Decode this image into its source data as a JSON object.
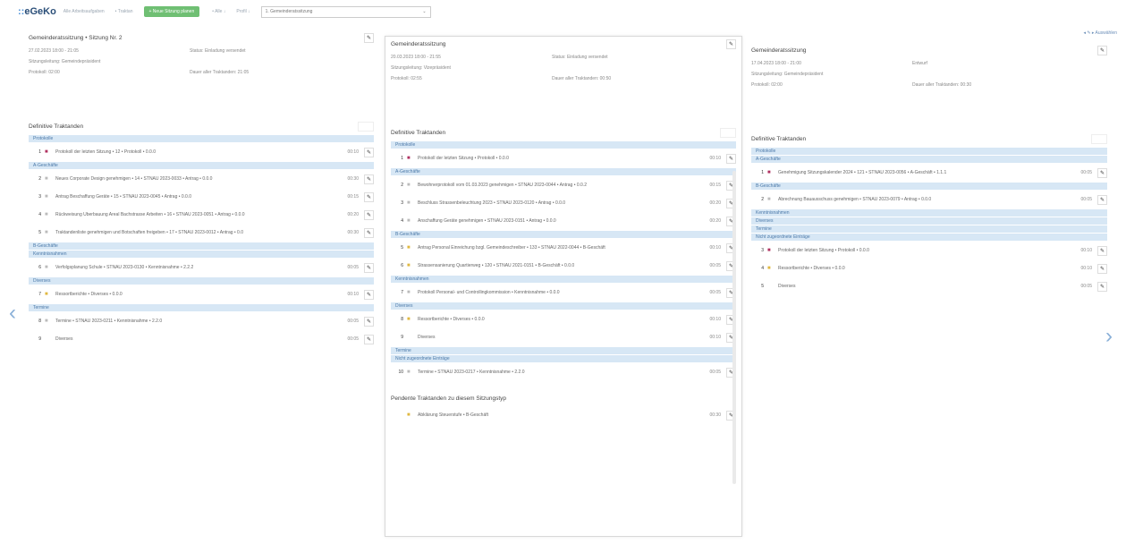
{
  "app": {
    "logo_prefix": "::",
    "logo": "eGeKo",
    "link": "Alle Arbeitsaufgaben"
  },
  "topbar": {
    "nav1": "• Traktan",
    "new_button": "+ Neue Sitzung planen",
    "nav2": "• Alle ↓",
    "nav3": "Profil ↓",
    "selected": "1. Gemeinderatssitzung",
    "caret": "⌄"
  },
  "top_right": "◂ ✎ ▸ Auswählen",
  "edit_symbol": "✎",
  "panels": {
    "left": {
      "title": "Gemeinderatssitzung • Sitzung Nr. 2",
      "meta": [
        "27.02.2023 18:00 - 21:05",
        "Status: Einladung versendet",
        "Sitzungsleitung: Gemeindepräsident",
        "",
        "Protokoll: 02:00",
        "Dauer aller Traktanden: 21:05"
      ],
      "section": "Definitive Traktanden",
      "groups": [
        {
          "cat": "Protokolle",
          "items": [
            {
              "n": "1",
              "dot": "■",
              "c": "#b03060",
              "t": "Protokoll der letzten Sitzung • 12 • Protokoll • 0.0.0",
              "time": "00:10"
            }
          ]
        },
        {
          "cat": "A-Geschäfte",
          "items": [
            {
              "n": "2",
              "dot": "■",
              "c": "#bbb",
              "t": "Neues Corporate Design genehmigen • 14 • STNAU 2023-0033 • Antrag • 0.0.0",
              "time": "00:30"
            },
            {
              "n": "3",
              "dot": "■",
              "c": "#bbb",
              "t": "Antrag Beschaffung Geräte • 15 • STNAU 2023-0045 • Antrag • 0.0.0",
              "time": "00:15"
            },
            {
              "n": "4",
              "dot": "■",
              "c": "#bbb",
              "t": "Rückweisung Überbauung Areal Bachstrasse Arbeiten • 16 • STNAU 2023-0051 • Antrag • 0.0.0",
              "time": "00:20"
            },
            {
              "n": "5",
              "dot": "■",
              "c": "#bbb",
              "t": "Traktandenliste genehmigen und Botschaften freigeben • 17 • STNAU 2023-0012 • Antrag • 0.0",
              "time": "00:30"
            }
          ]
        },
        {
          "cat": "B-Geschäfte",
          "items": []
        },
        {
          "cat": "Kenntnisnahmen",
          "items": [
            {
              "n": "6",
              "dot": "■",
              "c": "#bbb",
              "t": "Verfolgsplanung Schule • STNAU 2023-0130 • Kenntnisnahme • 2.2.2",
              "time": "00:05"
            }
          ]
        },
        {
          "cat": "Diverses",
          "items": [
            {
              "n": "7",
              "dot": "■",
              "c": "#e0b840",
              "t": "Ressortberichte • Diverses • 0.0.0",
              "time": "00:10"
            }
          ]
        },
        {
          "cat": "Termine",
          "items": [
            {
              "n": "8",
              "dot": "■",
              "c": "#bbb",
              "t": "Termine • STNAU 2023-0211 • Kenntnisnahme • 2.2.0",
              "time": "00:05"
            },
            {
              "n": "9",
              "dot": "",
              "c": "#bbb",
              "t": "Diverses",
              "time": "00:05"
            }
          ]
        }
      ]
    },
    "mid": {
      "title": "Gemeinderatssitzung",
      "meta": [
        "20.03.2023 18:00 - 21:55",
        "Status: Einladung versendet",
        "Sitzungsleitung: Vizepräsident",
        "",
        "Protokoll: 02:55",
        "Dauer aller Traktanden: 00:50"
      ],
      "section": "Definitive Traktanden",
      "groups": [
        {
          "cat": "Protokolle",
          "items": [
            {
              "n": "1",
              "dot": "■",
              "c": "#b03060",
              "t": "Protokoll der letzten Sitzung • Protokoll • 0.0.0",
              "time": "00:10"
            }
          ]
        },
        {
          "cat": "A-Geschäfte",
          "items": [
            {
              "n": "2",
              "dot": "■",
              "c": "#bbb",
              "t": "Bewohnerprotokoll vom 01.03.2023 genehmigen • STNAU 2023-0044 • Antrag • 0.0.2",
              "time": "00:15"
            },
            {
              "n": "3",
              "dot": "■",
              "c": "#bbb",
              "t": "Beschluss Strassenbeleuchtung 2023 • STNAU 2023-0120 • Antrag • 0.0.0",
              "time": "00:20"
            },
            {
              "n": "4",
              "dot": "■",
              "c": "#bbb",
              "t": "Anschaffung Geräte genehmigen • STNAU 2023-0151 • Antrag • 0.0.0",
              "time": "00:20"
            }
          ]
        },
        {
          "cat": "B-Geschäfte",
          "items": [
            {
              "n": "5",
              "dot": "■",
              "c": "#e0b840",
              "t": "Antrag Personal Einreichung bzgl. Gemeindeschreiber • 133 • STNAU 2022-0044 • B-Geschäft",
              "time": "00:10"
            },
            {
              "n": "6",
              "dot": "■",
              "c": "#e0b840",
              "t": "Strassensanierung Quartierweg • 120 • STNAU 2021-0151 • B-Geschäft • 0.0.0",
              "time": "00:05"
            }
          ]
        },
        {
          "cat": "Kenntnisnahmen",
          "items": [
            {
              "n": "7",
              "dot": "■",
              "c": "#bbb",
              "t": "Protokoll Personal- und Controllingkommission • Kenntnisnahme • 0.0.0",
              "time": "00:05"
            }
          ]
        },
        {
          "cat": "Diverses",
          "items": [
            {
              "n": "8",
              "dot": "■",
              "c": "#e0b840",
              "t": "Ressortberichte • Diverses • 0.0.0",
              "time": "00:10"
            },
            {
              "n": "9",
              "dot": "",
              "c": "#bbb",
              "t": "Diverses",
              "time": "00:10"
            }
          ]
        },
        {
          "cat": "Termine",
          "items": []
        },
        {
          "cat": "Nicht zugeordnete Einträge",
          "items": [
            {
              "n": "10",
              "dot": "■",
              "c": "#bbb",
              "t": "Termine • STNAU 2023-0217 • Kenntnisnahme • 2.2.0",
              "time": "00:05"
            }
          ]
        }
      ],
      "pending_title": "Pendente Traktanden zu diesem Sitzungstyp",
      "pending": [
        {
          "n": "",
          "dot": "■",
          "c": "#e0b840",
          "t": "Abklärung Steuerstufe • B-Geschäft",
          "time": "00:30"
        }
      ]
    },
    "right": {
      "title": "Gemeinderatssitzung",
      "meta": [
        "17.04.2023 18:00 - 21:00",
        "Entwurf",
        "Sitzungsleitung: Gemeindepräsident",
        "",
        "Protokoll: 02:00",
        "Dauer aller Traktanden: 00:30"
      ],
      "section": "Definitive Traktanden",
      "groups": [
        {
          "cat": "Protokolle",
          "items": []
        },
        {
          "cat": "A-Geschäfte",
          "items": [
            {
              "n": "1",
              "dot": "■",
              "c": "#b03060",
              "t": "Genehmigung Sitzungskalender 2024 • 121 • STNAU 2023-0056 • A-Geschäft • 1.1.1",
              "time": "00:05"
            }
          ]
        },
        {
          "cat": "B-Geschäfte",
          "items": [
            {
              "n": "2",
              "dot": "■",
              "c": "#bbb",
              "t": "Abrechnung Bauausschuss genehmigen • STNAU 2023-0079 • Antrag • 0.0.0",
              "time": "00:05"
            }
          ]
        },
        {
          "cat": "Kenntnisnahmen",
          "items": []
        },
        {
          "cat": "Diverses",
          "items": []
        },
        {
          "cat": "Termine",
          "items": []
        },
        {
          "cat": "Nicht zugeordnete Einträge",
          "items": [
            {
              "n": "3",
              "dot": "■",
              "c": "#b03060",
              "t": "Protokoll der letzten Sitzung • Protokoll • 0.0.0",
              "time": "00:10"
            },
            {
              "n": "4",
              "dot": "■",
              "c": "#e0b840",
              "t": "Ressortberichte • Diverses • 0.0.0",
              "time": "00:10"
            },
            {
              "n": "5",
              "dot": "",
              "c": "#bbb",
              "t": "Diverses",
              "time": "00:05"
            }
          ]
        }
      ]
    }
  },
  "nav": {
    "prev": "‹",
    "next": "›"
  }
}
